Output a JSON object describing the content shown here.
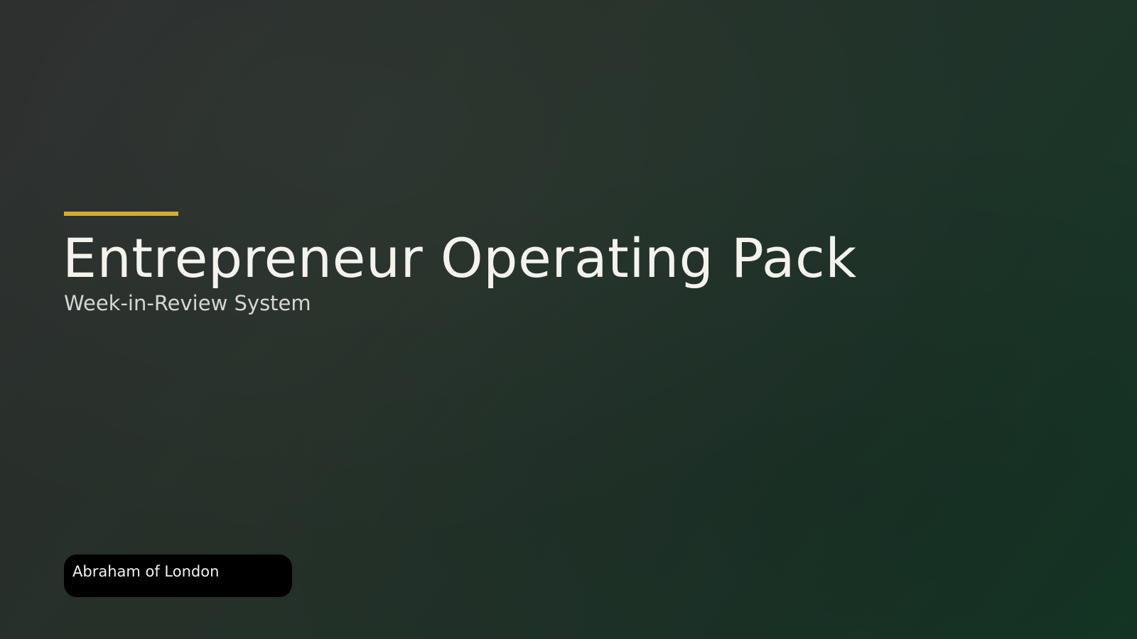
{
  "slide": {
    "title": "Entrepreneur Operating Pack",
    "subtitle": "Week-in-Review System",
    "author": "Abraham of London"
  },
  "colors": {
    "accent": "#d4ab2f",
    "background_start": "#2b2d2d",
    "background_end": "#143826",
    "title_text": "#f4f2ec",
    "badge_background": "#000000"
  }
}
